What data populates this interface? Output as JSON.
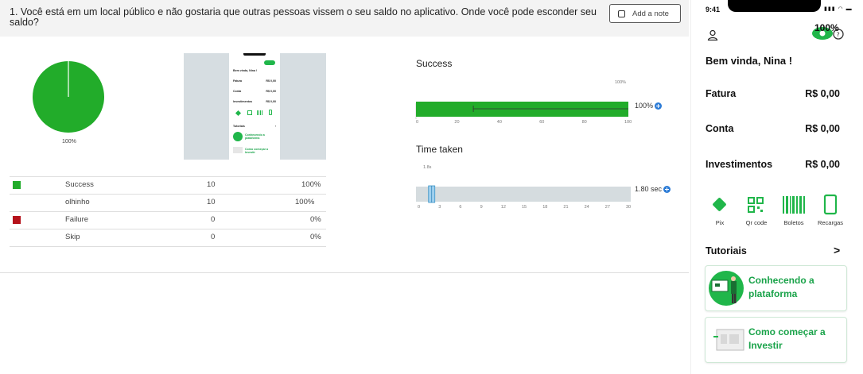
{
  "question": {
    "text": "1. Você está em um local público e não gostaria que outras pessoas vissem o seu saldo no aplicativo. Onde você pode esconder seu saldo?",
    "add_note_label": "Add a note"
  },
  "pie": {
    "percent_label": "100%",
    "success_fraction": 1.0,
    "color": "#22ac2a"
  },
  "results_table": [
    {
      "label": "Success",
      "count": "10",
      "percent": "100%",
      "color": "#22ac2a"
    },
    {
      "label": "olhinho",
      "count": "10",
      "percent": "100%",
      "color": ""
    },
    {
      "label": "Failure",
      "count": "0",
      "percent": "0%",
      "color": "#b5121b"
    },
    {
      "label": "Skip",
      "count": "0",
      "percent": "0%",
      "color": ""
    }
  ],
  "success_chart": {
    "title": "Success",
    "top_label": "100%",
    "value_label": "100%",
    "value": 100,
    "ticks": [
      "0",
      "20",
      "40",
      "60",
      "80",
      "100"
    ],
    "range_low": 27,
    "range_high": 100
  },
  "time_chart": {
    "title": "Time taken",
    "top_label": "1.8s",
    "value_label": "1.80 sec",
    "value": 1.8,
    "ticks": [
      "0",
      "3",
      "6",
      "9",
      "12",
      "15",
      "18",
      "21",
      "24",
      "27",
      "30"
    ],
    "xmax": 30
  },
  "thumbnail": {
    "welcome": "Bem vinda, Nina !",
    "rows": [
      {
        "label": "Fatura",
        "value": "R$ 0,00"
      },
      {
        "label": "Conta",
        "value": "R$ 0,00"
      },
      {
        "label": "Investimentos",
        "value": "R$ 0,00"
      }
    ],
    "tutorials": "Tutoriais",
    "card1": "Conhecendo a plataforma",
    "card2": "Como começar a Investir"
  },
  "phone": {
    "time": "9:41",
    "eye_percent": "100%",
    "welcome": "Bem vinda, Nina !",
    "rows": [
      {
        "label": "Fatura",
        "value": "R$ 0,00"
      },
      {
        "label": "Conta",
        "value": "R$ 0,00"
      },
      {
        "label": "Investimentos",
        "value": "R$ 0,00"
      }
    ],
    "actions": [
      {
        "label": "Pix",
        "icon": "pix-icon"
      },
      {
        "label": "Qr code",
        "icon": "qr-code-icon"
      },
      {
        "label": "Boletos",
        "icon": "barcode-icon"
      },
      {
        "label": "Recargas",
        "icon": "phone-recharge-icon"
      }
    ],
    "tutorials_title": "Tutoriais",
    "cards": [
      {
        "line1": "Conhecendo a",
        "line2": "plataforma"
      },
      {
        "line1": "Como começar a",
        "line2": "Investir"
      }
    ],
    "accent": "#1aa34a"
  }
}
